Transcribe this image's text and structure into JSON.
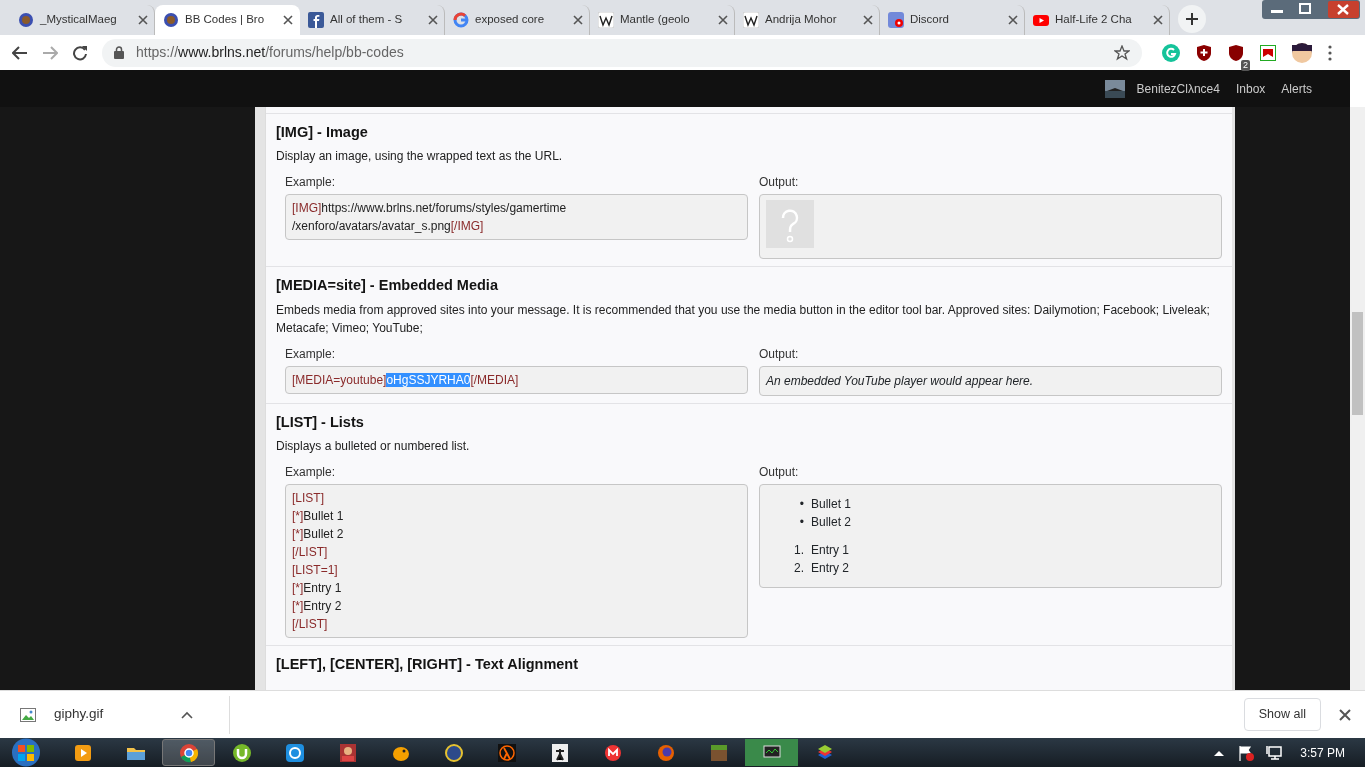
{
  "browser": {
    "tabs": [
      {
        "title": "_MysticalMaeg",
        "selected": false
      },
      {
        "title": "BB Codes | Bro",
        "selected": true
      },
      {
        "title": "All of them - S",
        "selected": false
      },
      {
        "title": "exposed core",
        "selected": false
      },
      {
        "title": "Mantle (geolo",
        "selected": false
      },
      {
        "title": "Andrija Mohor",
        "selected": false
      },
      {
        "title": "Discord",
        "selected": false
      },
      {
        "title": "Half-Life 2 Cha",
        "selected": false
      }
    ],
    "address": {
      "scheme": "https://",
      "host": "www.brlns.net",
      "path": "/forums/help/bb-codes"
    },
    "extension_badge": "2"
  },
  "forum_nav": {
    "user": "BenitezClλnce4",
    "links": [
      "Inbox",
      "Alerts"
    ]
  },
  "sections": [
    {
      "title": "[IMG] - Image",
      "description": "Display an image, using the wrapped text as the URL.",
      "example_label": "Example:",
      "output_label": "Output:",
      "example_lines": [
        [
          {
            "text": "[IMG]",
            "kind": "tag"
          },
          {
            "text": "https://www.brlns.net/forums/styles/gamertime",
            "kind": "text"
          }
        ],
        [
          {
            "text": "/xenforo/avatars/avatar_s.png",
            "kind": "text"
          },
          {
            "text": "[/IMG]",
            "kind": "tag"
          }
        ]
      ],
      "output": {
        "kind": "image"
      }
    },
    {
      "title": "[MEDIA=site] - Embedded Media",
      "description": "Embeds media from approved sites into your message. It is recommended that you use the media button in the editor tool bar. Approved sites: Dailymotion; Facebook; Liveleak; Metacafe; Vimeo; YouTube;",
      "example_label": "Example:",
      "output_label": "Output:",
      "example_lines": [
        [
          {
            "text": "[MEDIA=youtube]",
            "kind": "tag"
          },
          {
            "text": "oHgSSJYRHA0",
            "kind": "selected"
          },
          {
            "text": "[/MEDIA]",
            "kind": "tag"
          }
        ]
      ],
      "output": {
        "kind": "note",
        "text": "An embedded YouTube player would appear here."
      }
    },
    {
      "title": "[LIST] - Lists",
      "description": "Displays a bulleted or numbered list.",
      "example_label": "Example:",
      "output_label": "Output:",
      "example_lines": [
        [
          {
            "text": "[LIST]",
            "kind": "tag"
          }
        ],
        [
          {
            "text": "[*]",
            "kind": "tag"
          },
          {
            "text": "Bullet 1",
            "kind": "text"
          }
        ],
        [
          {
            "text": "[*]",
            "kind": "tag"
          },
          {
            "text": "Bullet 2",
            "kind": "text"
          }
        ],
        [
          {
            "text": "[/LIST]",
            "kind": "tag"
          }
        ],
        [
          {
            "text": "[LIST=1]",
            "kind": "tag"
          }
        ],
        [
          {
            "text": "[*]",
            "kind": "tag"
          },
          {
            "text": "Entry 1",
            "kind": "text"
          }
        ],
        [
          {
            "text": "[*]",
            "kind": "tag"
          },
          {
            "text": "Entry 2",
            "kind": "text"
          }
        ],
        [
          {
            "text": "[/LIST]",
            "kind": "tag"
          }
        ]
      ],
      "output": {
        "kind": "lists",
        "lists": [
          [
            {
              "marker": "•",
              "text": "Bullet 1"
            },
            {
              "marker": "•",
              "text": "Bullet 2"
            }
          ],
          [
            {
              "marker": "1.",
              "text": "Entry 1"
            },
            {
              "marker": "2.",
              "text": "Entry 2"
            }
          ]
        ]
      }
    },
    {
      "title": "[LEFT], [CENTER], [RIGHT] - Text Alignment"
    }
  ],
  "downloads": {
    "file": "giphy.gif",
    "show_all": "Show all"
  },
  "taskbar": {
    "time": "3:57 PM"
  }
}
